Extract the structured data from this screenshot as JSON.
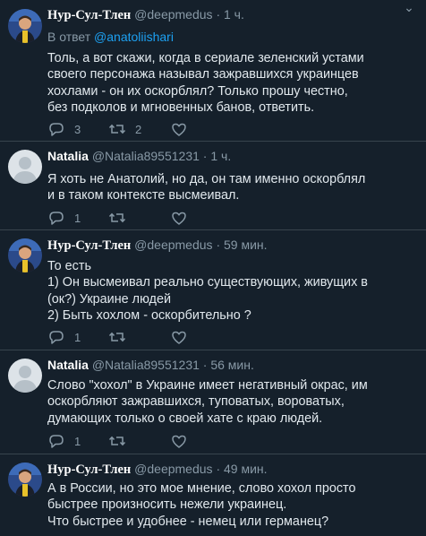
{
  "tweets": [
    {
      "name": "Нур-Сул-Тлен",
      "handle": "@deepmedus",
      "time": "· 1 ч.",
      "reply_label": "В ответ",
      "reply_to": "@anatoliishari",
      "lines": [
        "Толь, а вот скажи, когда в сериале зеленский устами",
        "своего персонажа называл зажравшихся украинцев",
        "хохлами - он их оскорблял? Только прошу честно,",
        "без подколов и мгновенных банов, ответить."
      ],
      "replies": "3",
      "retweets": "2"
    },
    {
      "name": "Natalia",
      "handle": "@Natalia89551231",
      "time": "· 1 ч.",
      "lines": [
        "Я хоть не Анатолий, но да, он там именно оскорблял",
        "и в таком контексте высмеивал."
      ],
      "replies": "1"
    },
    {
      "name": "Нур-Сул-Тлен",
      "handle": "@deepmedus",
      "time": "· 59 мин.",
      "lines": [
        "То есть",
        "1) Он высмеивал реально существующих, живущих в",
        "(ок?) Украине людей",
        "2) Быть хохлом - оскорбительно ?"
      ],
      "replies": "1"
    },
    {
      "name": "Natalia",
      "handle": "@Natalia89551231",
      "time": "· 56 мин.",
      "lines": [
        "Слово \"хохол\" в Украине имеет негативный окрас, им",
        "оскорбляют зажравшихся, туповатых, вороватых,",
        "думающих только о своей хате с краю людей."
      ],
      "replies": "1"
    },
    {
      "name": "Нур-Сул-Тлен",
      "handle": "@deepmedus",
      "time": "· 49 мин.",
      "lines": [
        "А в России, но это мое мнение, слово хохол просто",
        "быстрее произносить нежели украинец.",
        "Что быстрее и удобнее - немец или германец?"
      ]
    }
  ]
}
